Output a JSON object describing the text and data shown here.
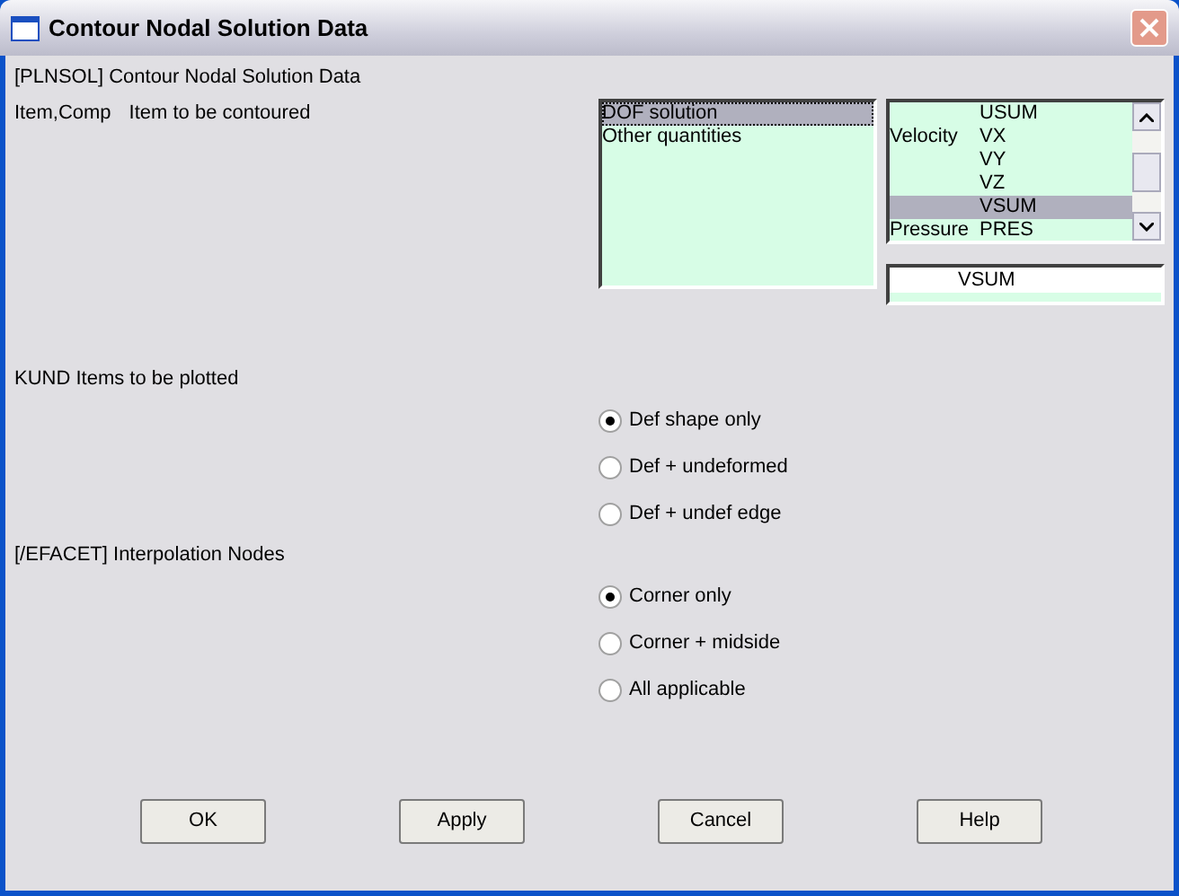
{
  "window": {
    "title": "Contour Nodal Solution Data"
  },
  "header": "[PLNSOL]  Contour Nodal Solution Data",
  "item_comp": {
    "key": "Item,Comp",
    "label": "Item to be contoured",
    "categories": [
      {
        "text": "DOF solution",
        "selected": true
      },
      {
        "text": "Other quantities",
        "selected": false
      }
    ],
    "components": [
      {
        "comp": "USUM",
        "selected": false
      },
      {
        "group": "Velocity",
        "comp": "VX",
        "selected": false
      },
      {
        "comp": "VY",
        "selected": false
      },
      {
        "comp": "VZ",
        "selected": false
      },
      {
        "comp": "VSUM",
        "selected": true
      },
      {
        "group": "Pressure",
        "comp": "PRES",
        "selected": false
      }
    ],
    "value": "VSUM"
  },
  "kund": {
    "label": "KUND   Items to be plotted",
    "options": [
      {
        "text": "Def shape only",
        "selected": true
      },
      {
        "text": "Def + undeformed",
        "selected": false
      },
      {
        "text": "Def + undef edge",
        "selected": false
      }
    ]
  },
  "efacet": {
    "label": "[/EFACET] Interpolation Nodes",
    "options": [
      {
        "text": "Corner only",
        "selected": true
      },
      {
        "text": "Corner + midside",
        "selected": false
      },
      {
        "text": "All applicable",
        "selected": false
      }
    ]
  },
  "buttons": [
    "OK",
    "Apply",
    "Cancel",
    "Help"
  ]
}
